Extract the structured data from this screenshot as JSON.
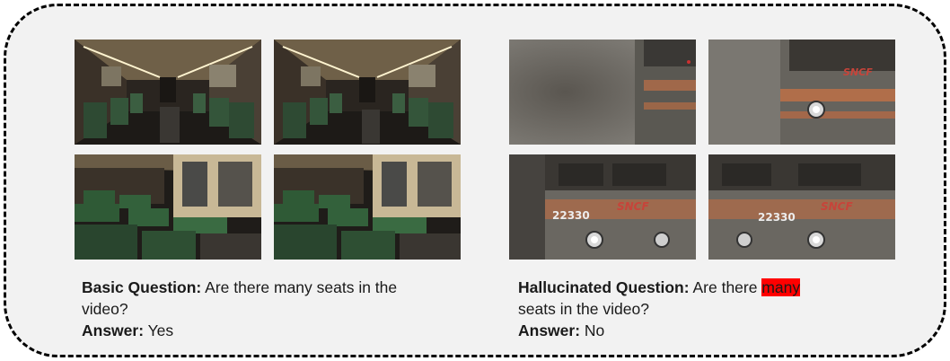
{
  "basic": {
    "question_label": "Basic Question:",
    "question_text_line1": "Are there many seats in the",
    "question_text_line2": "video?",
    "answer_label": "Answer:",
    "answer_value": "Yes"
  },
  "hallucinated": {
    "question_label": "Hallucinated Question:",
    "question_pre": "Are there",
    "question_highlight": "many",
    "question_post": "seats in the video?",
    "answer_label": "Answer:",
    "answer_value": "No",
    "highlight_color": "#ff0000"
  },
  "left_frames": [
    "train-interior-frame-1",
    "train-interior-frame-2",
    "train-interior-frame-3",
    "train-interior-frame-4"
  ],
  "right_frames": [
    "locomotive-frame-1",
    "locomotive-frame-2",
    "locomotive-frame-3",
    "locomotive-frame-4"
  ],
  "logo_text": "SNCF",
  "locomotive_number": "22330"
}
